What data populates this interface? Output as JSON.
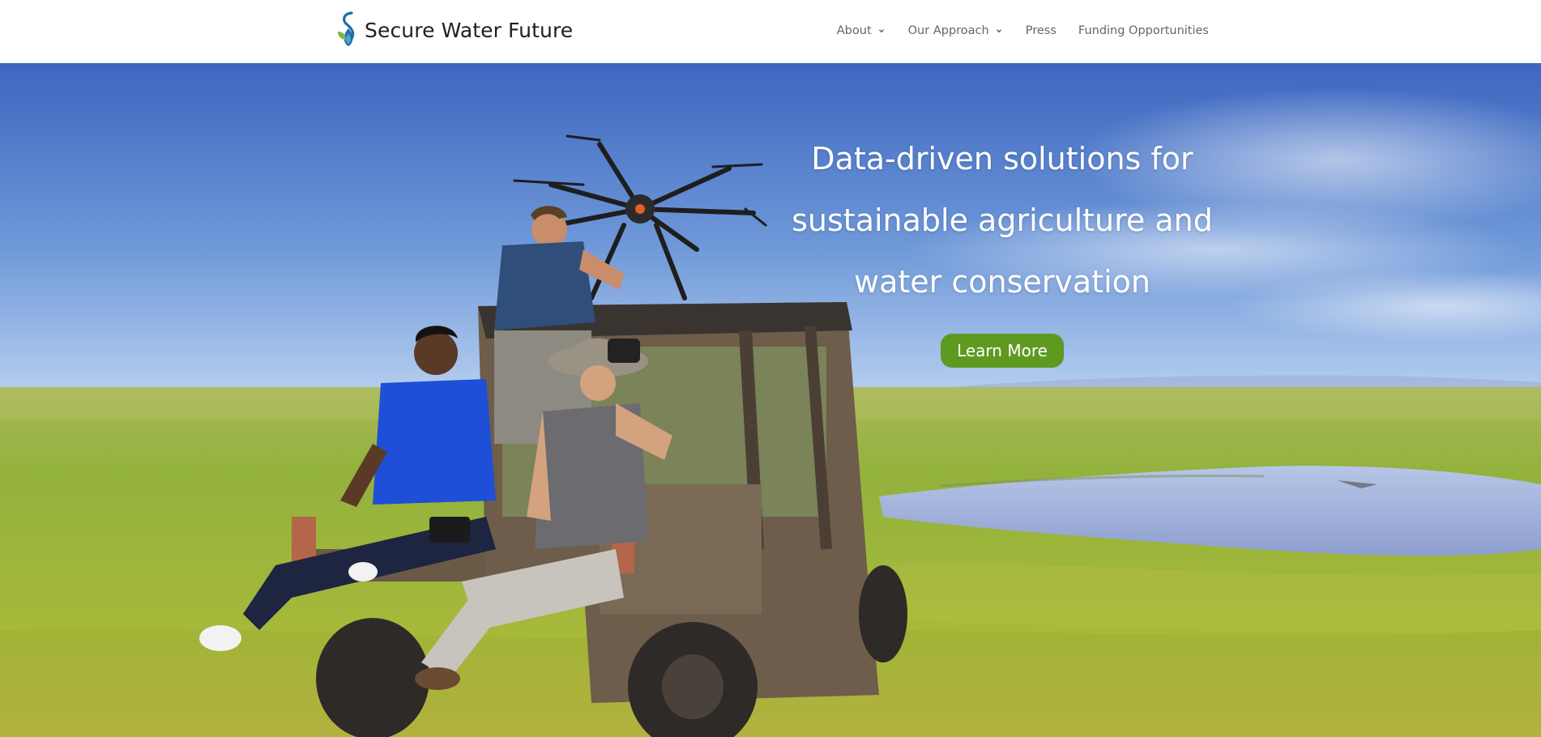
{
  "brand": {
    "name": "Secure Water Future",
    "logo_icon": "water-drop-leaf-logo",
    "colors": {
      "logo_blue": "#1e6fa8",
      "logo_green": "#7ab547"
    }
  },
  "nav": {
    "items": [
      {
        "label": "About",
        "has_dropdown": true
      },
      {
        "label": "Our Approach",
        "has_dropdown": true
      },
      {
        "label": "Press",
        "has_dropdown": false
      },
      {
        "label": "Funding Opportunities",
        "has_dropdown": false
      }
    ],
    "dropdown_icon": "chevron-down-icon",
    "text_color": "#666666"
  },
  "hero": {
    "headline_lines": [
      "Data-driven solutions for",
      "sustainable agriculture and",
      "water conservation"
    ],
    "cta_label": "Learn More",
    "cta_color": "#5e9a1f",
    "image": "photo: three people on a utility vehicle in a green field, one holding a hexacopter drone, one using binoculars, a pond in the background"
  }
}
